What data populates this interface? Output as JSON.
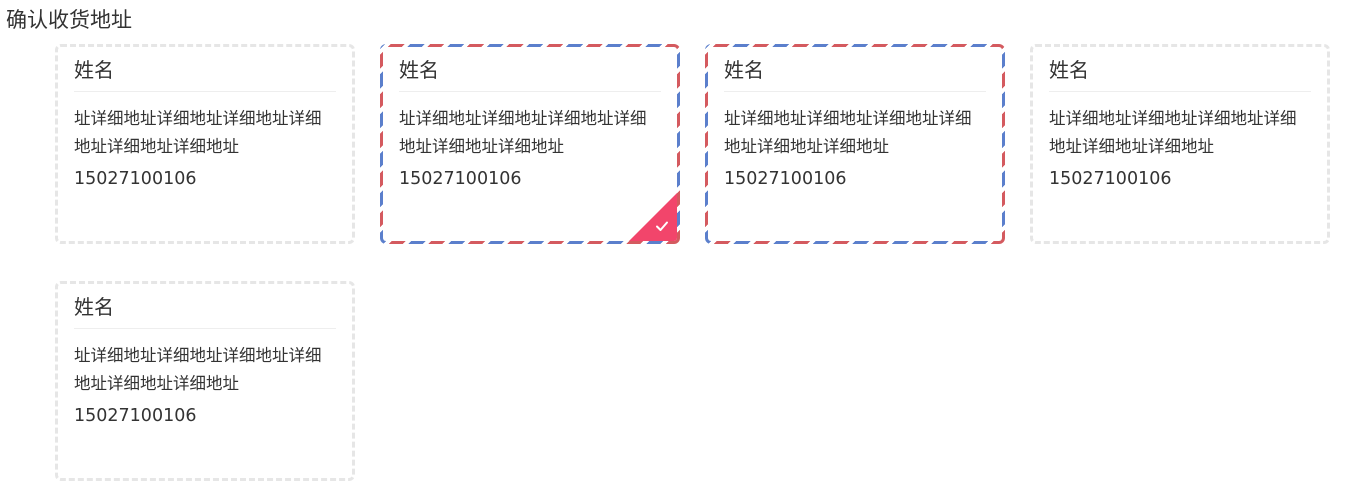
{
  "page": {
    "title": "确认收货地址"
  },
  "addresses": [
    {
      "name": "姓名",
      "address": "址详细地址详细地址详细地址详细地址详细地址详细地址",
      "phone": "15027100106",
      "style": "plain",
      "selected": false
    },
    {
      "name": "姓名",
      "address": "址详细地址详细地址详细地址详细地址详细地址详细地址",
      "phone": "15027100106",
      "style": "airmail",
      "selected": true
    },
    {
      "name": "姓名",
      "address": "址详细地址详细地址详细地址详细地址详细地址详细地址",
      "phone": "15027100106",
      "style": "airmail",
      "selected": false
    },
    {
      "name": "姓名",
      "address": "址详细地址详细地址详细地址详细地址详细地址详细地址",
      "phone": "15027100106",
      "style": "plain",
      "selected": false
    },
    {
      "name": "姓名",
      "address": "址详细地址详细地址详细地址详细地址详细地址详细地址",
      "phone": "15027100106",
      "style": "plain",
      "selected": false
    }
  ],
  "colors": {
    "selected_badge": "#f2456b",
    "airmail_red": "#d45a5f",
    "airmail_blue": "#5b7fcc",
    "dashed_border": "#e6e6e6"
  },
  "icons": {
    "selected_badge": "check-icon"
  }
}
